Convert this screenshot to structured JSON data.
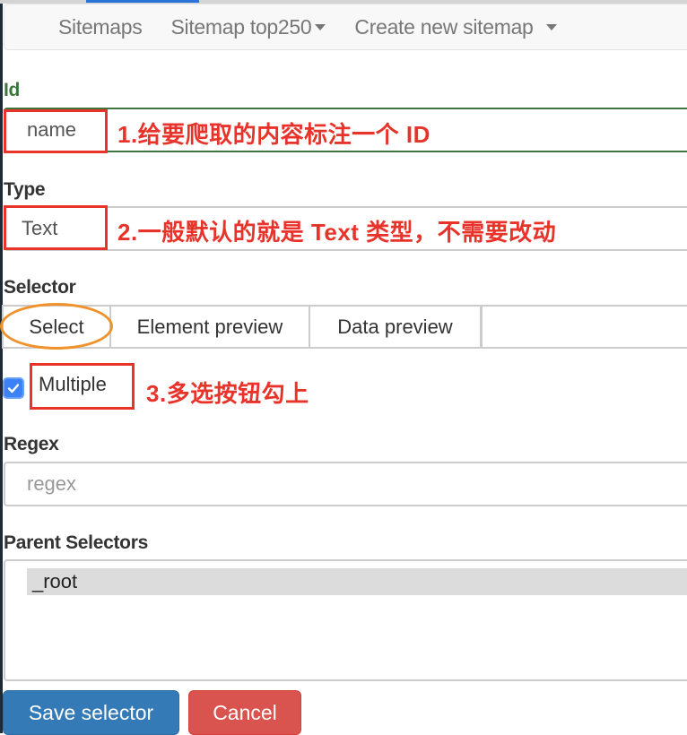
{
  "navbar": {
    "items": [
      {
        "label": "Sitemaps",
        "has_caret": false
      },
      {
        "label": "Sitemap top250",
        "has_caret": true
      },
      {
        "label": "Create new sitemap",
        "has_caret": true
      }
    ]
  },
  "form": {
    "id": {
      "label": "Id",
      "value": "name",
      "annotation": "1.给要爬取的内容标注一个 ID"
    },
    "type": {
      "label": "Type",
      "value": "Text",
      "annotation": "2.一般默认的就是 Text 类型，不需要改动"
    },
    "selector": {
      "label": "Selector",
      "tabs": [
        "Select",
        "Element preview",
        "Data preview"
      ]
    },
    "multiple": {
      "label": "Multiple",
      "checked": true,
      "annotation": "3.多选按钮勾上"
    },
    "regex": {
      "label": "Regex",
      "placeholder": "regex",
      "value": ""
    },
    "parent_selectors": {
      "label": "Parent Selectors",
      "options": [
        "_root"
      ],
      "selected": "_root"
    }
  },
  "buttons": {
    "save": "Save selector",
    "cancel": "Cancel"
  },
  "colors": {
    "annotation_red": "#e8332a",
    "highlight_orange": "#f0922c",
    "success_green": "#3c763d",
    "primary": "#337ab7",
    "danger": "#d9534f",
    "checkbox_blue": "#3b82f6"
  }
}
